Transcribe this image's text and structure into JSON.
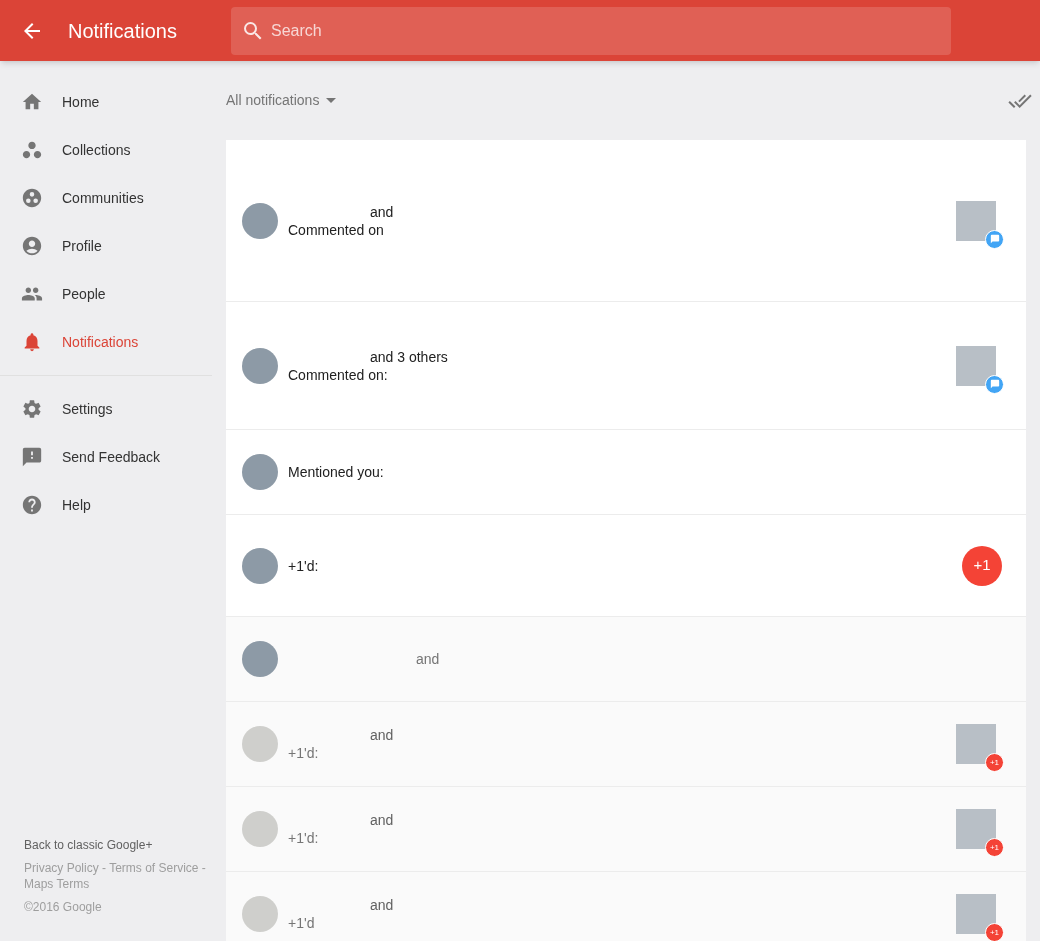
{
  "header": {
    "title": "Notifications",
    "search": {
      "placeholder": "Search"
    }
  },
  "sidebar": {
    "items": [
      {
        "label": "Home",
        "selected": false
      },
      {
        "label": "Collections",
        "selected": false
      },
      {
        "label": "Communities",
        "selected": false
      },
      {
        "label": "Profile",
        "selected": false
      },
      {
        "label": "People",
        "selected": false
      },
      {
        "label": "Notifications",
        "selected": true
      }
    ],
    "secondary_items": [
      {
        "label": "Settings"
      },
      {
        "label": "Send Feedback"
      },
      {
        "label": "Help"
      }
    ],
    "footer": {
      "classic_link": "Back to classic Google+",
      "links": "Privacy Policy - Terms of Service - Maps Terms",
      "copyright": "©2016 Google"
    }
  },
  "filter": {
    "label": "All notifications"
  },
  "notifications": [
    {
      "unread": true,
      "has_photo": true,
      "line1": "and",
      "line2": "Commented on",
      "marker": {
        "kind": "comment"
      }
    },
    {
      "unread": true,
      "has_photo": true,
      "line1": "and 3 others",
      "line2": "Commented on:",
      "marker": {
        "kind": "comment"
      }
    },
    {
      "unread": true,
      "has_photo": true,
      "line2": "Mentioned you:"
    },
    {
      "unread": true,
      "has_photo": true,
      "line2": "+1'd:",
      "marker": {
        "kind": "plus_button",
        "label": "+1"
      }
    },
    {
      "unread": false,
      "has_photo": true,
      "line2": "and"
    },
    {
      "unread": false,
      "has_photo": false,
      "line1": "and",
      "line2": "+1'd:",
      "marker": {
        "kind": "plus_badge",
        "label": "+1"
      }
    },
    {
      "unread": false,
      "has_photo": false,
      "line1": "and",
      "line2": "+1'd:",
      "marker": {
        "kind": "plus_badge",
        "label": "+1"
      }
    },
    {
      "unread": false,
      "has_photo": false,
      "line1": "and",
      "line2": "+1'd",
      "marker": {
        "kind": "plus_badge",
        "label": "+1"
      }
    }
  ]
}
